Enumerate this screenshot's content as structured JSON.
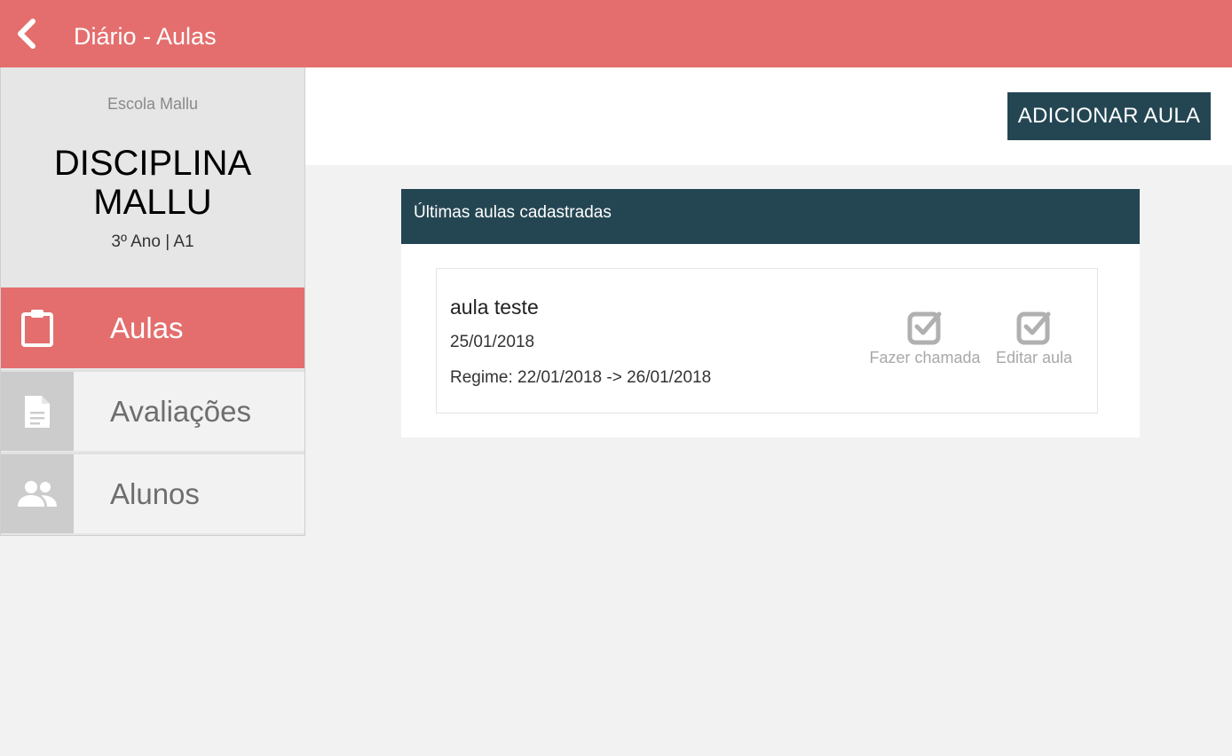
{
  "topbar": {
    "title": "Diário - Aulas",
    "back_icon": "chevron-left-icon"
  },
  "sidebar": {
    "school": "Escola Mallu",
    "discipline": "DISCIPLINA MALLU",
    "class_info": "3º Ano | A1",
    "items": [
      {
        "label": "Aulas",
        "icon": "clipboard-icon",
        "active": true
      },
      {
        "label": "Avaliações",
        "icon": "document-icon",
        "active": false
      },
      {
        "label": "Alunos",
        "icon": "people-icon",
        "active": false
      }
    ]
  },
  "main": {
    "add_button_label": "ADICIONAR AULA",
    "panel_title": "Últimas aulas cadastradas",
    "lessons": [
      {
        "title": "aula teste",
        "date": "25/01/2018",
        "regime": "Regime: 22/01/2018 -> 26/01/2018",
        "actions": [
          {
            "label": "Fazer chamada",
            "icon": "checkbox-checked-icon"
          },
          {
            "label": "Editar aula",
            "icon": "checkbox-checked-icon"
          }
        ]
      }
    ]
  },
  "colors": {
    "accent": "#e46e6e",
    "dark": "#244653",
    "background": "#f2f2f2"
  }
}
